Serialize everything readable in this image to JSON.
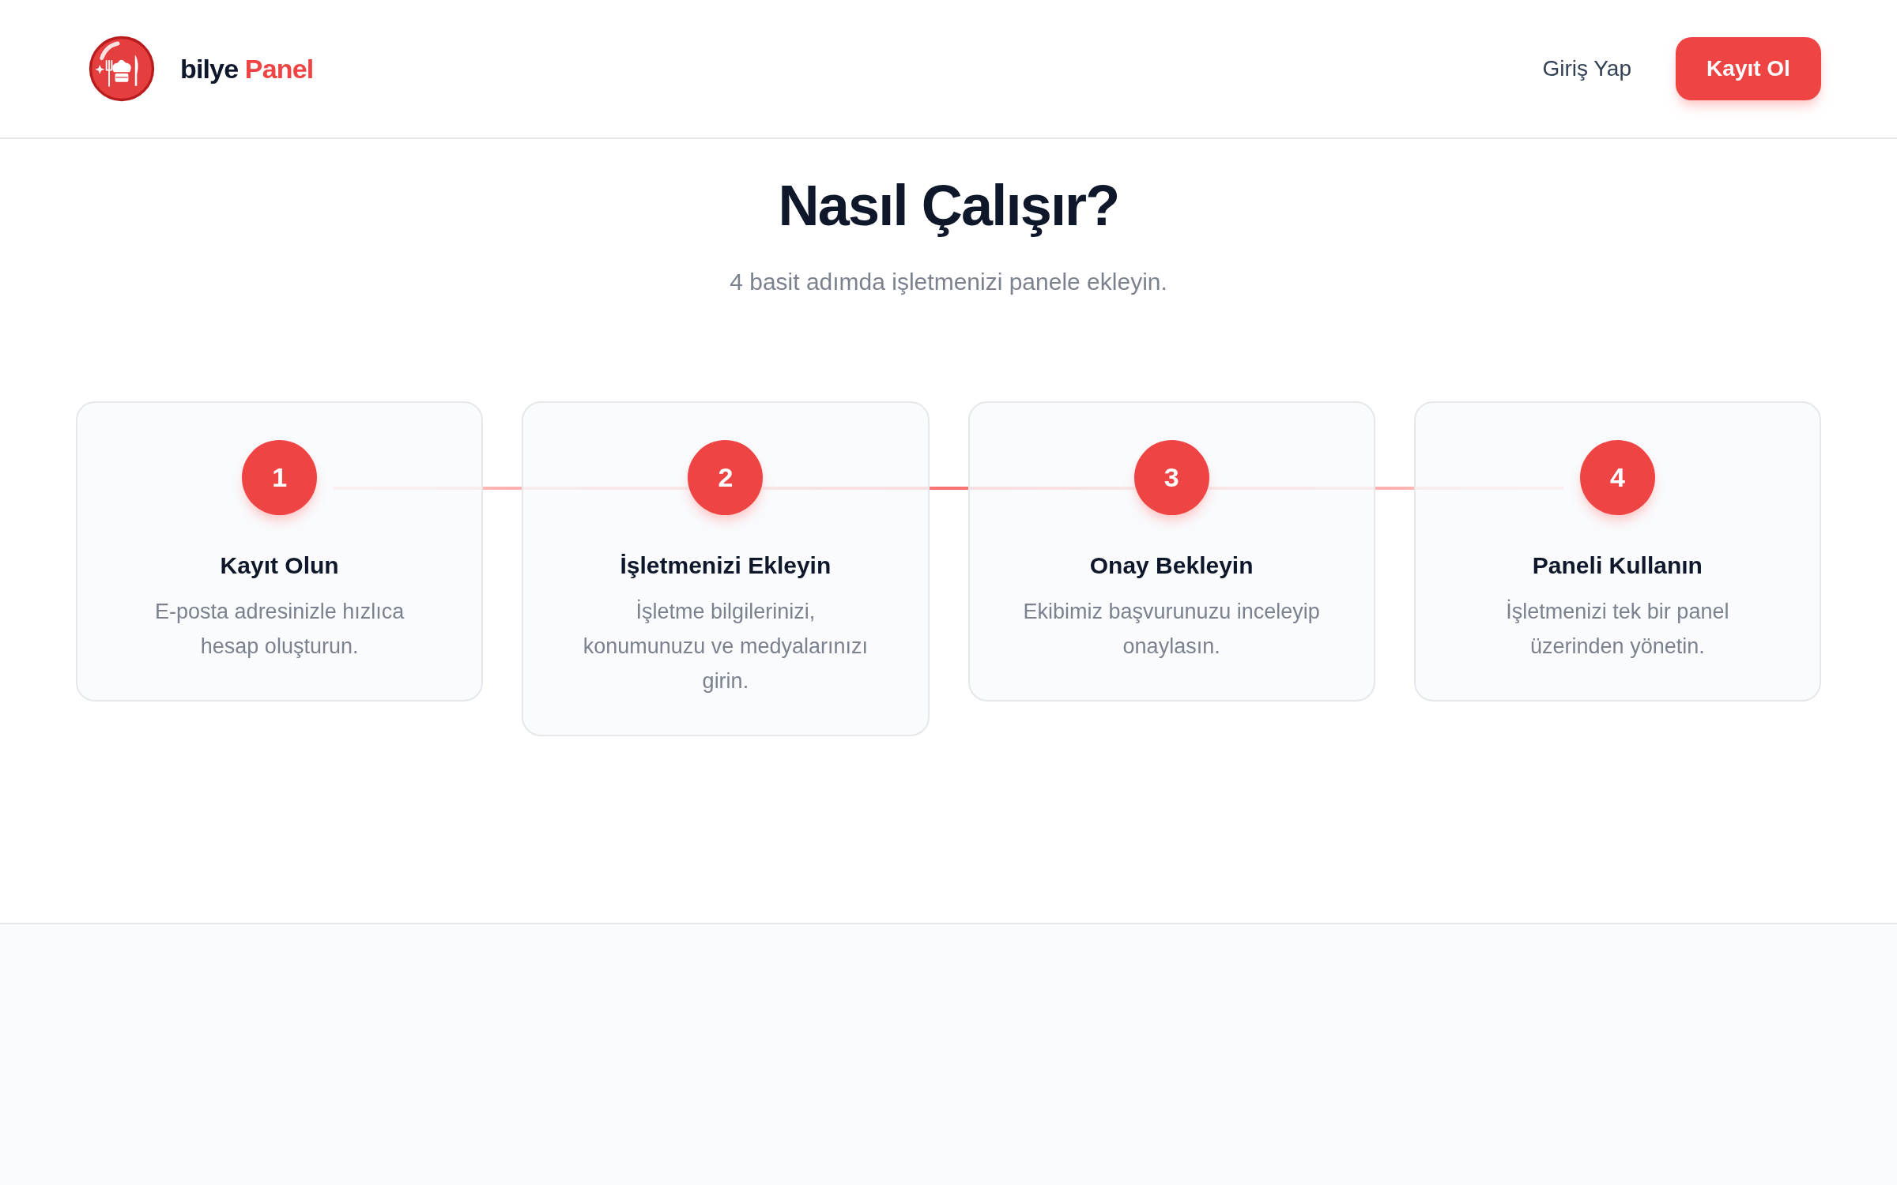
{
  "header": {
    "brand": {
      "name": "bilye",
      "accent": "Panel"
    },
    "nav": [
      {
        "label": "Giriş Yap",
        "kind": "link"
      },
      {
        "label": "Kayıt Ol",
        "kind": "primary"
      }
    ]
  },
  "section": {
    "title": "Nasıl Çalışır?",
    "subtitle": "4 basit adımda işletmenizi panele ekleyin."
  },
  "steps": [
    {
      "number": "1",
      "title": "Kayıt Olun",
      "description": "E-posta adresinizle hızlıca hesap oluşturun."
    },
    {
      "number": "2",
      "title": "İşletmenizi Ekleyin",
      "description": "İşletme bilgilerinizi, konumunuzu ve medyalarınızı girin."
    },
    {
      "number": "3",
      "title": "Onay Bekleyin",
      "description": "Ekibimiz başvurunuzu inceleyip onaylasın."
    },
    {
      "number": "4",
      "title": "Paneli Kullanın",
      "description": "İşletmenizi tek bir panel üzerinden yönetin."
    }
  ]
}
